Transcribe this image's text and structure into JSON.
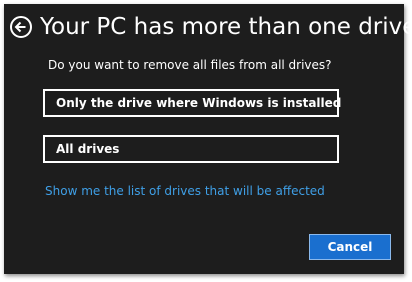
{
  "dialog": {
    "title": "Your PC has more than one drive",
    "question": "Do you want to remove all files from all drives?",
    "back_icon": "back-arrow-circle-icon"
  },
  "options": {
    "windows_drive_label": "Only the drive where Windows is installed",
    "all_drives_label": "All drives"
  },
  "link": {
    "show_drives_label": "Show me the list of drives that will be affected"
  },
  "actions": {
    "cancel_label": "Cancel"
  },
  "colors": {
    "background": "#1d1d1d",
    "text": "#ffffff",
    "link": "#3f9fe6",
    "accent_button": "#1a6fcf"
  }
}
